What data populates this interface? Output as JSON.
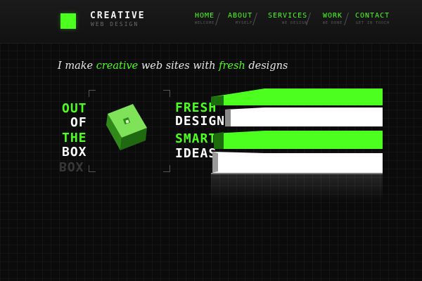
{
  "header": {
    "logo_title": "CREATIVE",
    "logo_subtitle": "WEB DESIGN",
    "nav": [
      {
        "label": "HOME",
        "sub": "WELCOME"
      },
      {
        "label": "ABOUT",
        "sub": "MYSELF"
      },
      {
        "label": "SERVICES",
        "sub": "WE DESIGN"
      },
      {
        "label": "WORK",
        "sub": "WE DONE"
      },
      {
        "label": "CONTACT",
        "sub": "GET IN TOUCH"
      }
    ]
  },
  "tagline": {
    "part1": "I make ",
    "highlight1": "creative",
    "part2": " web sites with ",
    "highlight2": "fresh",
    "part3": " designs"
  },
  "hero": {
    "left_words": [
      "OUT",
      "OF",
      "THE",
      "BOX"
    ],
    "right_words": [
      "FRESH",
      "DESIGNS",
      "SMART",
      "IDEAS"
    ]
  },
  "colors": {
    "accent": "#4cff1f",
    "background": "#0b0b0b",
    "header": "#161616"
  }
}
